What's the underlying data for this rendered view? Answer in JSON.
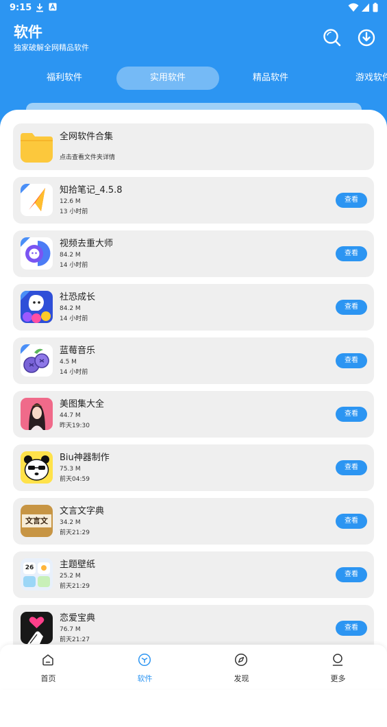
{
  "status": {
    "time": "9:15"
  },
  "header": {
    "title": "软件",
    "subtitle": "独家破解全网精品软件"
  },
  "tabs": [
    {
      "label": "福利软件",
      "active": false
    },
    {
      "label": "实用软件",
      "active": true
    },
    {
      "label": "精品软件",
      "active": false
    },
    {
      "label": "游戏软件",
      "active": false
    }
  ],
  "folder": {
    "title": "全网软件合集",
    "subtitle": "点击查看文件夹详情"
  },
  "apps": [
    {
      "name": "知拾笔记_4.5.8",
      "size": "12.6 M",
      "time": "13 小时前",
      "button": "查看",
      "icon": "arrow-logo-icon"
    },
    {
      "name": "视频去重大师",
      "size": "84.2 M",
      "time": "14 小时前",
      "button": "查看",
      "icon": "video-dedupe-icon"
    },
    {
      "name": "社恐成长",
      "size": "84.2 M",
      "time": "14 小时前",
      "button": "查看",
      "icon": "social-growth-icon"
    },
    {
      "name": "蓝莓音乐",
      "size": "4.5 M",
      "time": "14 小时前",
      "button": "查看",
      "icon": "blueberry-icon"
    },
    {
      "name": "美图集大全",
      "size": "44.7 M",
      "time": "昨天19:30",
      "button": "查看",
      "icon": "portrait-icon"
    },
    {
      "name": "Biu神器制作",
      "size": "75.3 M",
      "time": "前天04:59",
      "button": "查看",
      "icon": "panda-icon"
    },
    {
      "name": "文言文字典",
      "size": "34.2 M",
      "time": "前天21:29",
      "button": "查看",
      "icon": "dictionary-icon",
      "icon_text": "文言文"
    },
    {
      "name": "主题壁纸",
      "size": "25.2 M",
      "time": "前天21:29",
      "button": "查看",
      "icon": "wallpaper-widgets-icon",
      "icon_text": "26"
    },
    {
      "name": "恋爱宝典",
      "size": "76.7 M",
      "time": "前天21:27",
      "button": "查看",
      "icon": "heart-hand-icon"
    }
  ],
  "bottom_nav": [
    {
      "label": "首页",
      "icon": "home-icon",
      "active": false
    },
    {
      "label": "软件",
      "icon": "cube-icon",
      "active": true
    },
    {
      "label": "发现",
      "icon": "compass-icon",
      "active": false
    },
    {
      "label": "更多",
      "icon": "person-icon",
      "active": false
    }
  ],
  "colors": {
    "primary": "#2c95f2",
    "card": "#efefef",
    "folder": "#fcc83c"
  }
}
